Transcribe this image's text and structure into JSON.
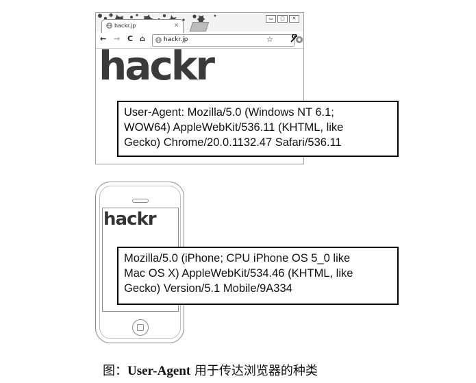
{
  "browser": {
    "tab_title": "hackr.jp",
    "tab_close": "×",
    "window_controls": [
      "▭",
      "▢",
      "✕"
    ],
    "nav": {
      "back": "←",
      "forward": "→",
      "reload": "C",
      "home": "⌂"
    },
    "url": "hackr.jp",
    "star": "☆",
    "logo": "hackr"
  },
  "callout_desktop": {
    "text": "User-Agent: Mozilla/5.0 (Windows NT 6.1;\nWOW64) AppleWebKit/536.11 (KHTML, like\nGecko) Chrome/20.0.1132.47 Safari/536.11"
  },
  "phone": {
    "logo": "hackr"
  },
  "callout_mobile": {
    "text": "Mozilla/5.0 (iPhone; CPU iPhone OS 5_0 like\nMac OS X) AppleWebKit/534.46 (KHTML, like\nGecko) Version/5.1 Mobile/9A334"
  },
  "caption": {
    "prefix": "图：",
    "bold": "User-Agent",
    "suffix": " 用于传达浏览器的种类"
  },
  "icons": [
    "globe-icon",
    "star-icon",
    "extension-icon",
    "wrench-icon",
    "floral-decoration"
  ]
}
